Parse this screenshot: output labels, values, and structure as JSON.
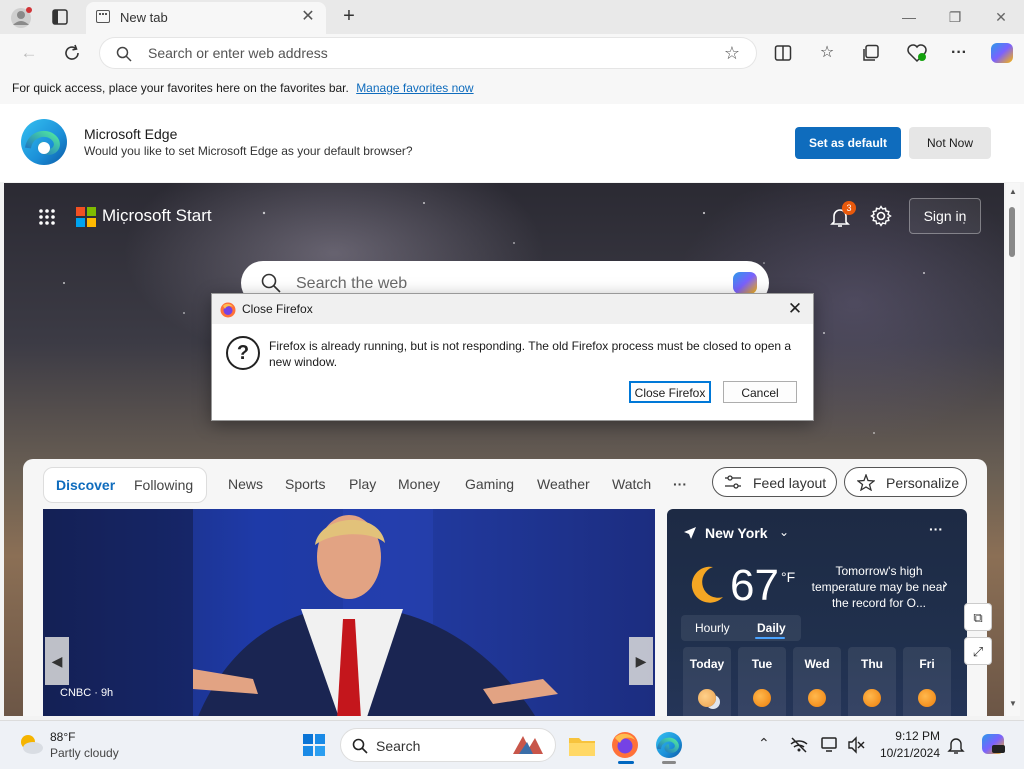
{
  "browser": {
    "tab_title": "New tab",
    "address_placeholder": "Search or enter web address"
  },
  "favorites_bar": {
    "message": "For quick access, place your favorites here on the favorites bar.",
    "link": "Manage favorites now"
  },
  "default_banner": {
    "title": "Microsoft Edge",
    "subtitle": "Would you like to set Microsoft Edge as your default browser?",
    "primary_button": "Set as default",
    "secondary_button": "Not Now"
  },
  "start_page": {
    "brand": "Microsoft Start",
    "notification_count": "3",
    "sign_in": "Sign in",
    "search_placeholder": "Search the web",
    "feed_tabs": {
      "discover": "Discover",
      "following": "Following",
      "items": [
        "News",
        "Sports",
        "Play",
        "Money",
        "Gaming",
        "Weather",
        "Watch"
      ],
      "more": "···"
    },
    "feed_layout_button": "Feed layout",
    "personalize_button": "Personalize",
    "hero_source": "CNBC · 9h",
    "weather": {
      "city": "New York",
      "temperature": "67",
      "unit": "°F",
      "note": "Tomorrow's high temperature may be near the record for O...",
      "toggle_hourly": "Hourly",
      "toggle_daily": "Daily",
      "days": [
        "Today",
        "Tue",
        "Wed",
        "Thu",
        "Fri"
      ]
    }
  },
  "dialog": {
    "title": "Close Firefox",
    "message": "Firefox is already running, but is not responding. The old Firefox process must be closed to open a new window.",
    "primary_button": "Close Firefox",
    "cancel_button": "Cancel"
  },
  "taskbar": {
    "weather_temp": "88°F",
    "weather_desc": "Partly cloudy",
    "search_placeholder": "Search",
    "time": "9:12 PM",
    "date": "10/21/2024"
  },
  "colors": {
    "accent": "#0f6cbd",
    "dialog_focus": "#0078d7",
    "notification_badge": "#e8590c"
  }
}
